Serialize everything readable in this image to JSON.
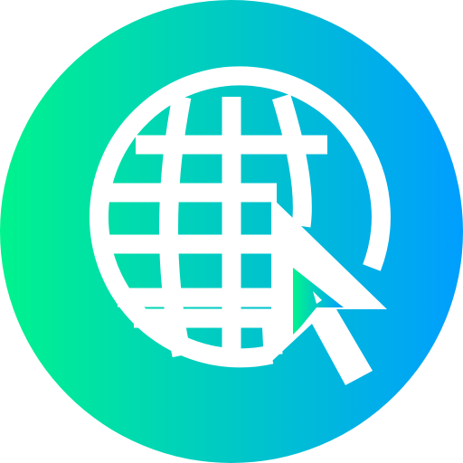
{
  "icon": {
    "name": "globe-with-cursor-icon",
    "gradient_start": "#00F38D",
    "gradient_end": "#009EFF",
    "glyph_color": "#FFFFFF"
  }
}
